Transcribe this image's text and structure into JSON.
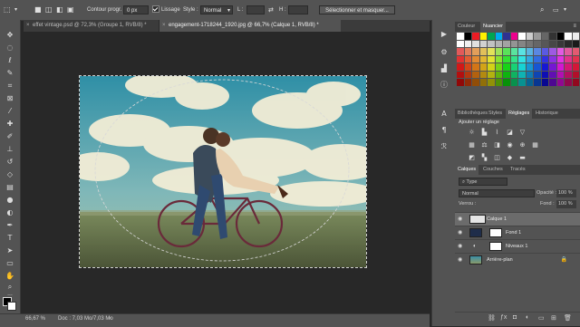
{
  "options_bar": {
    "feather_label": "Contour progr. :",
    "feather_value": "0 px",
    "antialias_label": "Lissage",
    "style_label": "Style :",
    "style_value": "Normal",
    "width_label": "L :",
    "height_label": "H :",
    "select_mask_button": "Sélectionner et masquer..."
  },
  "tabs": [
    {
      "label": "effet vintage.psd @ 72,3% (Groupe 1, RVB/8) *",
      "active": false
    },
    {
      "label": "engagement-1718244_1920.jpg @ 66,7% (Calque 1, RVB/8) *",
      "active": true
    }
  ],
  "status": {
    "zoom": "66,67 %",
    "doc": "Doc : 7,03 Mo/7,03 Mo"
  },
  "swatches_panel": {
    "tabs": [
      "Couleur",
      "Nuancier"
    ],
    "active_tab": "Nuancier"
  },
  "adjustments_panel": {
    "tabs": [
      "Bibliothèques",
      "Styles",
      "Réglages",
      "Historique"
    ],
    "active_tab": "Réglages",
    "heading": "Ajouter un réglage"
  },
  "layers_panel": {
    "tabs": [
      "Calques",
      "Couches",
      "Tracés"
    ],
    "active_tab": "Calques",
    "filter_value": "Type",
    "blend_mode": "Normal",
    "opacity_label": "Opacité :",
    "opacity_value": "100 %",
    "lock_label": "Verrou :",
    "fill_label": "Fond :",
    "fill_value": "100 %",
    "layers": [
      {
        "name": "Calque 1",
        "selected": true
      },
      {
        "name": "Fond 1",
        "selected": false
      },
      {
        "name": "Niveaux 1",
        "selected": false
      },
      {
        "name": "Arrière-plan",
        "selected": false
      }
    ]
  },
  "colors": {
    "ui_dark": "#282828",
    "ui_panel": "#535353",
    "accent": "#1473e6"
  }
}
